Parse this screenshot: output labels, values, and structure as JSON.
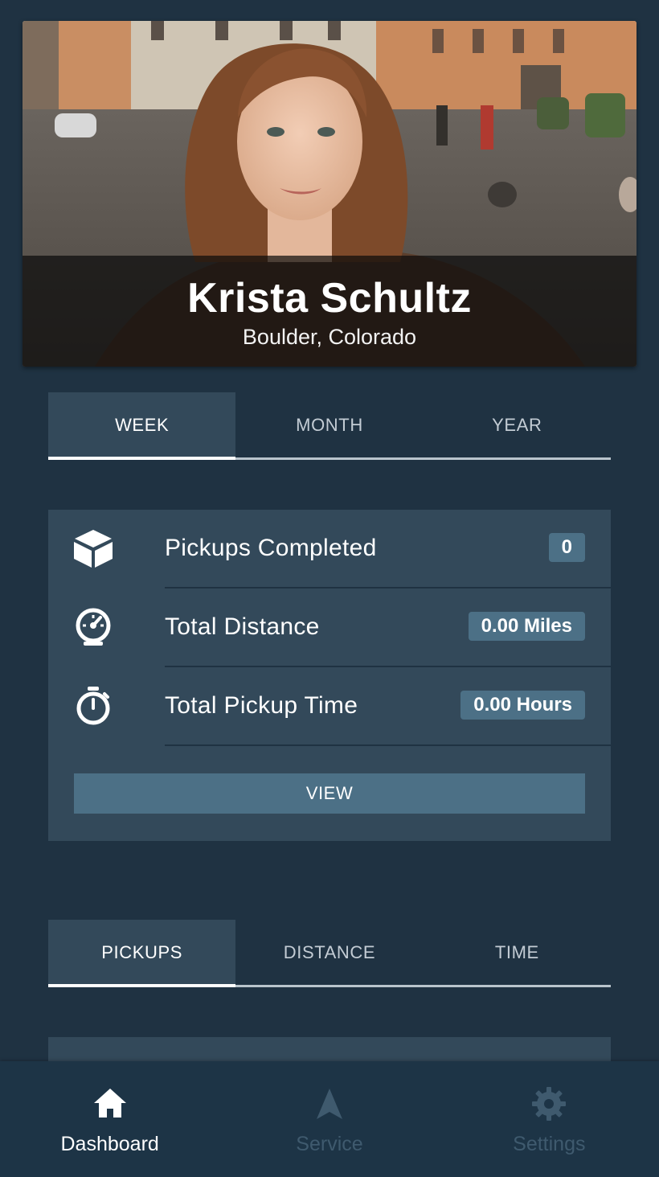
{
  "profile": {
    "name": "Krista Schultz",
    "location": "Boulder, Colorado",
    "photo_icon": "profile-photo"
  },
  "period_tabs": [
    {
      "label": "WEEK",
      "active": true
    },
    {
      "label": "MONTH",
      "active": false
    },
    {
      "label": "YEAR",
      "active": false
    }
  ],
  "stats": [
    {
      "icon": "box-icon",
      "label": "Pickups Completed",
      "value": "0"
    },
    {
      "icon": "speedometer-icon",
      "label": "Total Distance",
      "value": "0.00 Miles"
    },
    {
      "icon": "stopwatch-icon",
      "label": "Total Pickup Time",
      "value": "0.00 Hours"
    }
  ],
  "view_button": {
    "label": "VIEW"
  },
  "chart_tabs": [
    {
      "label": "PICKUPS",
      "active": true
    },
    {
      "label": "DISTANCE",
      "active": false
    },
    {
      "label": "TIME",
      "active": false
    }
  ],
  "bottom_nav": [
    {
      "icon": "home-icon",
      "label": "Dashboard",
      "active": true
    },
    {
      "icon": "navigation-arrow-icon",
      "label": "Service",
      "active": false
    },
    {
      "icon": "gear-icon",
      "label": "Settings",
      "active": false
    }
  ],
  "colors": {
    "background": "#1f3242",
    "card": "#33495a",
    "accent": "#4c7086",
    "inactive_nav": "#3f5a6e"
  }
}
